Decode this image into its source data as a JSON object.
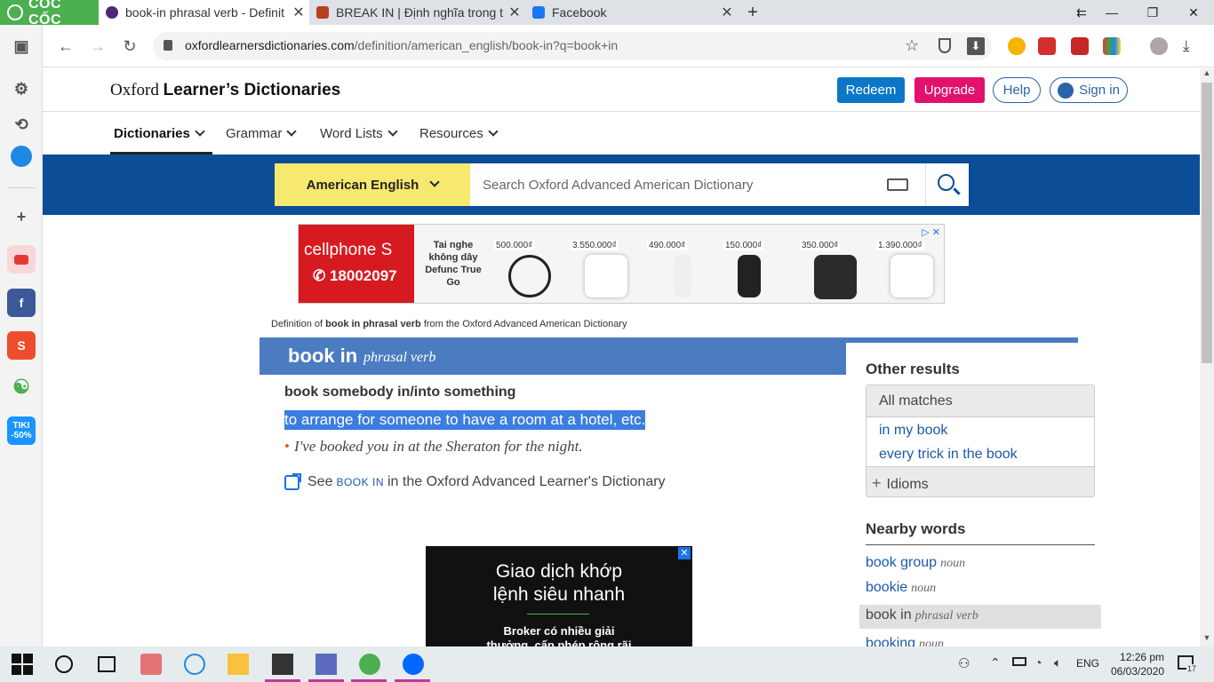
{
  "browser": {
    "brand": "CỐC CỐC",
    "tabs": [
      {
        "title": "book-in phrasal verb - Definit",
        "active": true,
        "color": "#4b2a7b"
      },
      {
        "title": "BREAK IN | Định nghĩa trong t",
        "active": false,
        "color": "#b8401f"
      },
      {
        "title": "Facebook",
        "active": false,
        "color": "#1877f2"
      }
    ],
    "url_domain": "oxfordlearnersdictionaries.com",
    "url_path": "/definition/american_english/book-in?q=book+in"
  },
  "site": {
    "logo_left": "Oxford",
    "logo_right": "Learner’s Dictionaries",
    "buttons": {
      "redeem": "Redeem",
      "upgrade": "Upgrade",
      "help": "Help",
      "signin": "Sign in"
    },
    "menu": [
      "Dictionaries",
      "Grammar",
      "Word Lists",
      "Resources"
    ],
    "dict_select": "American English",
    "search_placeholder": "Search Oxford Advanced American Dictionary"
  },
  "ad_top": {
    "brand": "cellphone S",
    "phone": "✆ 18002097",
    "desc": "Tai nghe không dây Defunc True Go",
    "prices": [
      "500.000₫",
      "3.550.000₫",
      "490.000₫",
      "150.000₫",
      "350.000₫",
      "1.390.000₫"
    ]
  },
  "entry": {
    "source_prefix": "Definition of",
    "source_bold": "book in phrasal verb",
    "source_suffix": "from the Oxford Advanced American Dictionary",
    "headword": "book in",
    "pos": "phrasal verb",
    "pattern": "book somebody in/into something",
    "definition": "to arrange for someone to have a room at a hotel, etc.",
    "example": "I've booked you in at the Sheraton for the night.",
    "see_prefix": "See",
    "see_link": "book in",
    "see_suffix": "in the Oxford Advanced Learner's Dictionary"
  },
  "ad_bottom": {
    "headline_1": "Giao dịch khớp",
    "headline_2": "lệnh siêu nhanh",
    "sub_1": "Broker có nhiều giải",
    "sub_2": "thưởng, cấp phép rộng rãi"
  },
  "sidebar_right": {
    "other_results": "Other results",
    "all_matches": "All matches",
    "matches": [
      "in my book",
      "every trick in the book"
    ],
    "idioms": "Idioms",
    "nearby_title": "Nearby words",
    "nearby": [
      {
        "word": "book group",
        "pos": "noun"
      },
      {
        "word": "bookie",
        "pos": "noun"
      },
      {
        "word": "book in",
        "pos": "phrasal verb"
      },
      {
        "word": "booking",
        "pos": "noun"
      }
    ]
  },
  "taskbar": {
    "lang": "ENG",
    "time": "12:26 pm",
    "date": "06/03/2020",
    "notif_count": "17"
  },
  "left_sidebar": {
    "tiki": "TIKI -50%"
  }
}
